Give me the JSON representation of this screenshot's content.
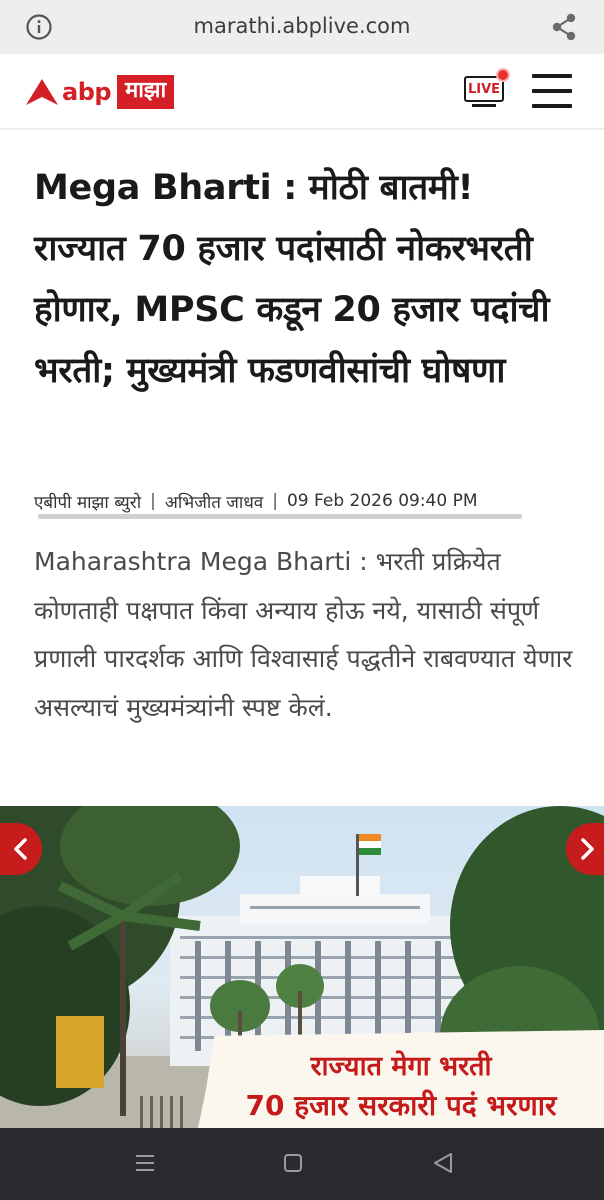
{
  "browser": {
    "url": "marathi.abplive.com",
    "icons": {
      "info": "info-icon",
      "share": "share-icon"
    }
  },
  "site": {
    "logo_text": "abp",
    "logo_badge": "माझा",
    "live_label": "LIVE",
    "brand_color": "#d51f26",
    "icons": {
      "menu": "hamburger-menu-icon",
      "live": "live-tv-icon"
    }
  },
  "article": {
    "headline": "Mega Bharti : मोठी बातमी! राज्यात 70 हजार पदांसाठी नोकरभरती होणार, MPSC कडून 20 हजार पदांची भरती; मुख्यमंत्री फडणवीसांची घोषणा",
    "byline": {
      "desk": "एबीपी माझा ब्युरो",
      "author": "अभिजीत जाधव",
      "datetime": "09 Feb 2026 09:40 PM"
    },
    "summary": "Maharashtra Mega Bharti : भरती प्रक्रियेत कोणताही पक्षपात किंवा अन्याय होऊ नये, यासाठी संपूर्ण प्रणाली पारदर्शक आणि विश्वासार्ह पद्धतीने राबवण्यात येणार असल्याचं मुख्यमंत्र्यांनी स्पष्ट केलं.",
    "image": {
      "banner_line1": "राज्यात मेगा भरती",
      "banner_line2": "70 हजार सरकारी पदं भरणार",
      "icons": {
        "prev": "chevron-left-icon",
        "next": "chevron-right-icon"
      }
    }
  },
  "system_nav": {
    "icons": {
      "recent": "recent-apps-icon",
      "home": "home-icon",
      "back": "back-icon"
    }
  }
}
